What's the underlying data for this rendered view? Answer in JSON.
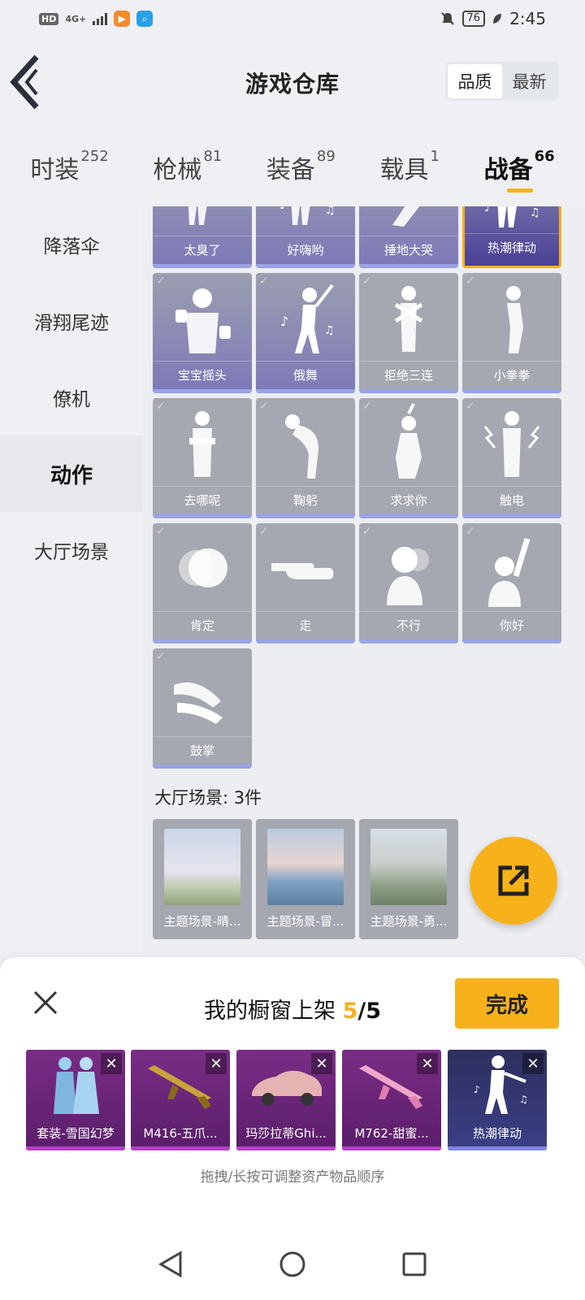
{
  "status_bar": {
    "hd": "HD",
    "network": "4G+",
    "battery": "76",
    "time": "2:45"
  },
  "header": {
    "title": "游戏仓库",
    "sort_options": [
      "品质",
      "最新"
    ],
    "sort_active": "品质"
  },
  "categories": [
    {
      "label": "时装",
      "count": "252"
    },
    {
      "label": "枪械",
      "count": "81"
    },
    {
      "label": "装备",
      "count": "89"
    },
    {
      "label": "载具",
      "count": "1"
    },
    {
      "label": "战备",
      "count": "66"
    }
  ],
  "sidebar": {
    "items": [
      "降落伞",
      "滑翔尾迹",
      "僚机",
      "动作",
      "大厅场景"
    ],
    "active": "动作"
  },
  "emotes": {
    "row0": [
      "太臭了",
      "好嗨哟",
      "捶地大哭",
      "热潮律动"
    ],
    "row1": [
      "宝宝摇头",
      "俄舞",
      "拒绝三连",
      "小拳拳"
    ],
    "row2": [
      "去哪呢",
      "鞠躬",
      "求求你",
      "触电"
    ],
    "row3": [
      "肯定",
      "走",
      "不行",
      "你好"
    ],
    "row4": [
      "鼓掌"
    ]
  },
  "scenes": {
    "title": "大厅场景: 3件",
    "items": [
      "主题场景-晴...",
      "主题场景-冒...",
      "主题场景-勇..."
    ]
  },
  "panel": {
    "title": "我的橱窗上架",
    "current": "5",
    "total": "/5",
    "done_label": "完成",
    "items": [
      "套装-雪国幻梦",
      "M416-五爪...",
      "玛莎拉蒂Ghi...",
      "M762-甜蜜...",
      "热潮律动"
    ],
    "hint": "拖拽/长按可调整资产物品顺序"
  },
  "colors": {
    "accent": "#f7b21b",
    "tile_gray": "#a5a8b0",
    "tile_purple": "#7d78b8",
    "shelf_purple": "#7a2d86"
  }
}
